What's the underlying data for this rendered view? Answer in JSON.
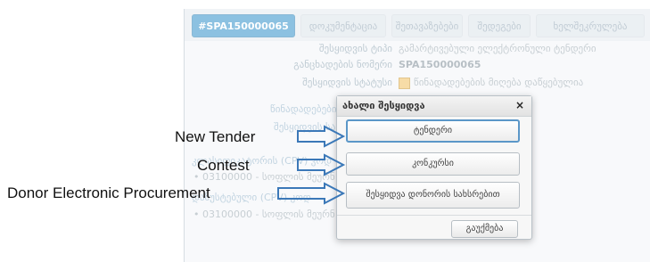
{
  "colors": {
    "accent": "#2f8fc8",
    "arrow": "#3b78b8"
  },
  "tabs": [
    {
      "label": "#SPA150000065",
      "active": true
    },
    {
      "label": "დოკუმენტაცია"
    },
    {
      "label": "შეთავაზებები"
    },
    {
      "label": "შედეგები"
    },
    {
      "label": "ხელშეკრულება"
    }
  ],
  "info": {
    "type_label": "შესყიდვის ტიპი",
    "type_value": "გამარტივებული ელექტრონული ტენდერი",
    "number_label": "განცხადების ნომერი",
    "number_value": "SPA150000065",
    "status_label": "შესყიდვის სტატუსი",
    "status_value": "წინადადებების მიღება დაწყებულია"
  },
  "left": {
    "proposals_label": "წინადადებები",
    "amount_label": "შესყიდვის სახ",
    "cpv_label_1": "კლასიფიკატორის (CPV) კოდ",
    "cpv_item_1": "• 03100000 - სოფლის მეურნ",
    "cpv_label_2": "დაზუსტებული (CPV) კოდ",
    "cpv_item_2": "• 03100000 - სოფლის მეურნ"
  },
  "modal": {
    "title": "ახალი შესყიდვა",
    "close": "×",
    "buttons": [
      "ტენდერი",
      "კონკურსი",
      "შესყიდვა დონორის სახსრებით"
    ],
    "cancel": "გაუქმება"
  },
  "annotations": {
    "new_tender": "New Tender",
    "contest": "Contest",
    "donor": "Donor Electronic Procurement"
  }
}
